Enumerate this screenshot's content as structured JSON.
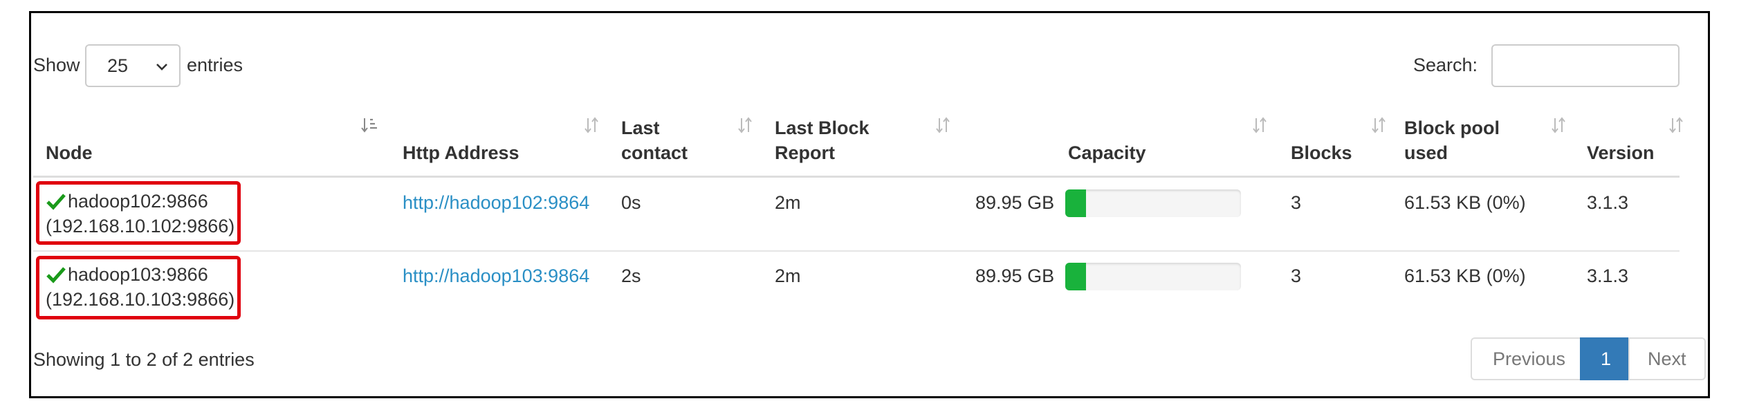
{
  "length": {
    "show_label": "Show",
    "selected": "25",
    "entries_label": "entries"
  },
  "search": {
    "label": "Search:",
    "value": ""
  },
  "columns": [
    {
      "label_line1": "Node",
      "label_line2": ""
    },
    {
      "label_line1": "Http Address",
      "label_line2": ""
    },
    {
      "label_line1": "Last",
      "label_line2": "contact"
    },
    {
      "label_line1": "Last Block",
      "label_line2": "Report"
    },
    {
      "label_line1": "Capacity",
      "label_line2": ""
    },
    {
      "label_line1": "Blocks",
      "label_line2": ""
    },
    {
      "label_line1": "Block pool",
      "label_line2": "used"
    },
    {
      "label_line1": "Version",
      "label_line2": ""
    }
  ],
  "rows": [
    {
      "node": "hadoop102:9866",
      "node_ip": "(192.168.10.102:9866)",
      "http": "http://hadoop102:9864",
      "last_contact": "0s",
      "last_block_report": "2m",
      "capacity": "89.95 GB",
      "capacity_used_fraction": 0.12,
      "blocks": "3",
      "block_pool_used": "61.53 KB (0%)",
      "version": "3.1.3"
    },
    {
      "node": "hadoop103:9866",
      "node_ip": "(192.168.10.103:9866)",
      "http": "http://hadoop103:9864",
      "last_contact": "2s",
      "last_block_report": "2m",
      "capacity": "89.95 GB",
      "capacity_used_fraction": 0.12,
      "blocks": "3",
      "block_pool_used": "61.53 KB (0%)",
      "version": "3.1.3"
    }
  ],
  "info": "Showing 1 to 2 of 2 entries",
  "pagination": {
    "previous": "Previous",
    "current": "1",
    "next": "Next"
  },
  "colors": {
    "accent": "#337ab7",
    "link": "#2a8fc5",
    "bar_fill": "#19b23c",
    "highlight": "#e0000d",
    "check": "#1a9a1a"
  },
  "icons": {
    "sort": "sort-both-icon",
    "sort_active": "sort-asc-icon",
    "check": "check-icon",
    "chevron": "chevron-down-icon"
  }
}
